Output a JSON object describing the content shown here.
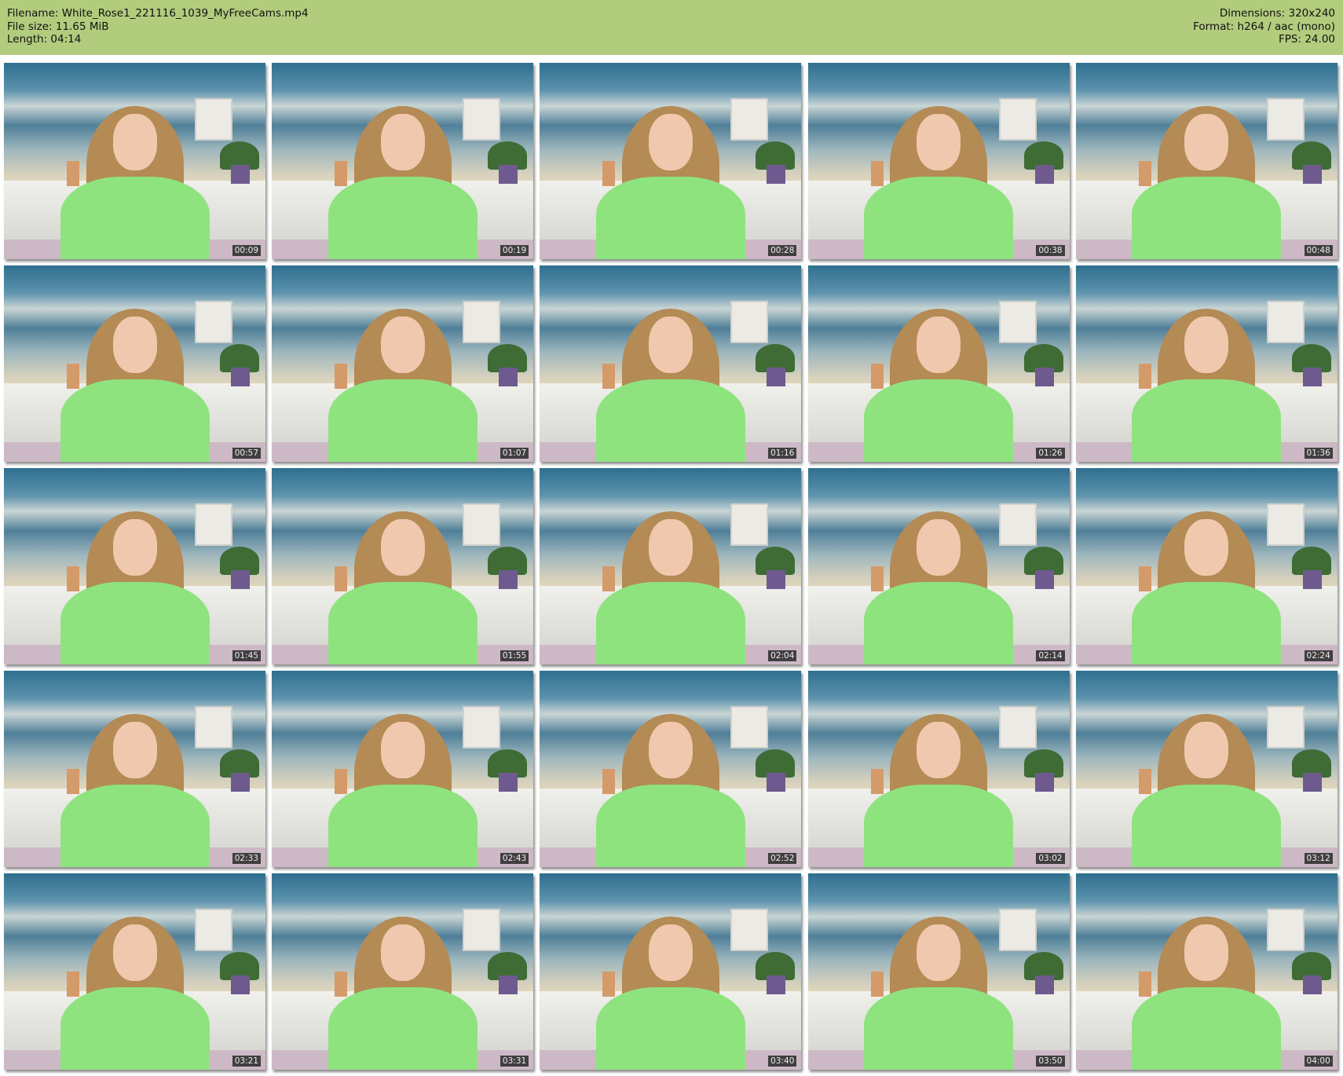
{
  "header": {
    "filename": "Filename: White_Rose1_221116_1039_MyFreeCams.mp4",
    "filesize": "File size: 11.65 MiB",
    "length": "Length: 04:14",
    "dimensions": "Dimensions: 320x240",
    "format": "Format: h264 / aac (mono)",
    "fps": "FPS: 24.00"
  },
  "colors": {
    "header_bg": "#b2cc7d"
  },
  "thumbnails": [
    "00:09",
    "00:19",
    "00:28",
    "00:38",
    "00:48",
    "00:57",
    "01:07",
    "01:16",
    "01:26",
    "01:36",
    "01:45",
    "01:55",
    "02:04",
    "02:14",
    "02:24",
    "02:33",
    "02:43",
    "02:52",
    "03:02",
    "03:12",
    "03:21",
    "03:31",
    "03:40",
    "03:50",
    "04:00"
  ]
}
